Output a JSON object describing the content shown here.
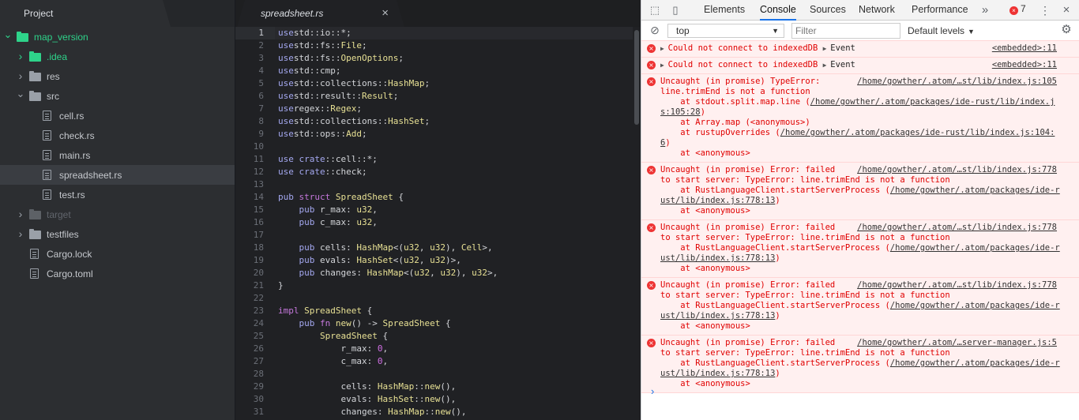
{
  "tree": {
    "tab_title": "Project",
    "items": [
      {
        "label": "map_version",
        "kind": "folder",
        "depth": 0,
        "expanded": true,
        "git": true
      },
      {
        "label": ".idea",
        "kind": "folder",
        "depth": 1,
        "expanded": false,
        "git": true
      },
      {
        "label": "res",
        "kind": "folder",
        "depth": 1,
        "expanded": false
      },
      {
        "label": "src",
        "kind": "folder",
        "depth": 1,
        "expanded": true
      },
      {
        "label": "cell.rs",
        "kind": "file",
        "depth": 2
      },
      {
        "label": "check.rs",
        "kind": "file",
        "depth": 2
      },
      {
        "label": "main.rs",
        "kind": "file",
        "depth": 2
      },
      {
        "label": "spreadsheet.rs",
        "kind": "file",
        "depth": 2,
        "selected": true
      },
      {
        "label": "test.rs",
        "kind": "file",
        "depth": 2
      },
      {
        "label": "target",
        "kind": "folder",
        "depth": 1,
        "expanded": false,
        "dim": true
      },
      {
        "label": "testfiles",
        "kind": "folder",
        "depth": 1,
        "expanded": false
      },
      {
        "label": "Cargo.lock",
        "kind": "file",
        "depth": 1
      },
      {
        "label": "Cargo.toml",
        "kind": "file",
        "depth": 1
      }
    ]
  },
  "editor": {
    "tab_title": "spreadsheet.rs",
    "close_glyph": "×",
    "active_line": 1,
    "lines": [
      [
        [
          "kw2",
          "use"
        ],
        [
          "",
          "std::io::*;"
        ]
      ],
      [
        [
          "kw2",
          "use"
        ],
        [
          "",
          "std::fs::"
        ],
        [
          "ty",
          "File"
        ],
        [
          "",
          ";"
        ]
      ],
      [
        [
          "kw2",
          "use"
        ],
        [
          "",
          "std::fs::"
        ],
        [
          "ty",
          "OpenOptions"
        ],
        [
          "",
          ";"
        ]
      ],
      [
        [
          "kw2",
          "use"
        ],
        [
          "",
          "std::cmp;"
        ]
      ],
      [
        [
          "kw2",
          "use"
        ],
        [
          "",
          "std::collections::"
        ],
        [
          "ty",
          "HashMap"
        ],
        [
          "",
          ";"
        ]
      ],
      [
        [
          "kw2",
          "use"
        ],
        [
          "",
          "std::result::"
        ],
        [
          "ty",
          "Result"
        ],
        [
          "",
          ";"
        ]
      ],
      [
        [
          "kw2",
          "use"
        ],
        [
          "",
          "regex::"
        ],
        [
          "ty",
          "Regex"
        ],
        [
          "",
          ";"
        ]
      ],
      [
        [
          "kw2",
          "use"
        ],
        [
          "",
          "std::collections::"
        ],
        [
          "ty",
          "HashSet"
        ],
        [
          "",
          ";"
        ]
      ],
      [
        [
          "kw2",
          "use"
        ],
        [
          "",
          "std::ops::"
        ],
        [
          "ty",
          "Add"
        ],
        [
          "",
          ";"
        ]
      ],
      [],
      [
        [
          "kw2",
          "use"
        ],
        [
          "",
          ""
        ],
        [
          "kw2",
          "crate"
        ],
        [
          "",
          "::cell::*;"
        ]
      ],
      [
        [
          "kw2",
          "use"
        ],
        [
          "",
          ""
        ],
        [
          "kw2",
          "crate"
        ],
        [
          "",
          "::check;"
        ]
      ],
      [],
      [
        [
          "kw2",
          "pub"
        ],
        [
          "",
          ""
        ],
        [
          "kw",
          "struct"
        ],
        [
          "",
          ""
        ],
        [
          "ty",
          "SpreadSheet"
        ],
        [
          "",
          ""
        ],
        [
          "",
          "{"
        ]
      ],
      [
        [
          "",
          "    "
        ],
        [
          "kw2",
          "pub"
        ],
        [
          "",
          ""
        ],
        [
          "",
          "r_max: "
        ],
        [
          "ty",
          "u32"
        ],
        [
          "",
          ","
        ]
      ],
      [
        [
          "",
          "    "
        ],
        [
          "kw2",
          "pub"
        ],
        [
          "",
          ""
        ],
        [
          "",
          "c_max: "
        ],
        [
          "ty",
          "u32"
        ],
        [
          "",
          ","
        ]
      ],
      [],
      [
        [
          "",
          "    "
        ],
        [
          "kw2",
          "pub"
        ],
        [
          "",
          ""
        ],
        [
          "",
          "cells: "
        ],
        [
          "ty",
          "HashMap"
        ],
        [
          "",
          "<("
        ],
        [
          "ty",
          "u32"
        ],
        [
          "",
          ", "
        ],
        [
          "ty",
          "u32"
        ],
        [
          "",
          "), "
        ],
        [
          "ty",
          "Cell"
        ],
        [
          "",
          ">,"
        ]
      ],
      [
        [
          "",
          "    "
        ],
        [
          "kw2",
          "pub"
        ],
        [
          "",
          ""
        ],
        [
          "",
          "evals: "
        ],
        [
          "ty",
          "HashSet"
        ],
        [
          "",
          "<("
        ],
        [
          "ty",
          "u32"
        ],
        [
          "",
          ", "
        ],
        [
          "ty",
          "u32"
        ],
        [
          "",
          ")>,"
        ]
      ],
      [
        [
          "",
          "    "
        ],
        [
          "kw2",
          "pub"
        ],
        [
          "",
          ""
        ],
        [
          "",
          "changes: "
        ],
        [
          "ty",
          "HashMap"
        ],
        [
          "",
          "<("
        ],
        [
          "ty",
          "u32"
        ],
        [
          "",
          ", "
        ],
        [
          "ty",
          "u32"
        ],
        [
          "",
          "), "
        ],
        [
          "ty",
          "u32"
        ],
        [
          "",
          ">,"
        ]
      ],
      [
        [
          "",
          "}"
        ]
      ],
      [],
      [
        [
          "kw",
          "impl"
        ],
        [
          "",
          ""
        ],
        [
          "ty",
          "SpreadSheet"
        ],
        [
          "",
          ""
        ],
        [
          "",
          "{"
        ]
      ],
      [
        [
          "",
          "    "
        ],
        [
          "kw2",
          "pub"
        ],
        [
          "",
          ""
        ],
        [
          "kw",
          "fn"
        ],
        [
          "",
          ""
        ],
        [
          "ty",
          "new"
        ],
        [
          "",
          "() -> "
        ],
        [
          "ty",
          "SpreadSheet"
        ],
        [
          "",
          ""
        ],
        [
          "",
          "{"
        ]
      ],
      [
        [
          "",
          "        "
        ],
        [
          "ty",
          "SpreadSheet"
        ],
        [
          "",
          ""
        ],
        [
          "",
          "{"
        ]
      ],
      [
        [
          "",
          "            "
        ],
        [
          "",
          "r_max: "
        ],
        [
          "nm",
          "0"
        ],
        [
          "",
          ","
        ]
      ],
      [
        [
          "",
          "            "
        ],
        [
          "",
          "c_max: "
        ],
        [
          "nm",
          "0"
        ],
        [
          "",
          ","
        ]
      ],
      [],
      [
        [
          "",
          "            "
        ],
        [
          "",
          "cells: "
        ],
        [
          "ty",
          "HashMap"
        ],
        [
          "",
          "::"
        ],
        [
          "ty",
          "new"
        ],
        [
          "",
          "(),"
        ]
      ],
      [
        [
          "",
          "            "
        ],
        [
          "",
          "evals: "
        ],
        [
          "ty",
          "HashSet"
        ],
        [
          "",
          "::"
        ],
        [
          "ty",
          "new"
        ],
        [
          "",
          "(),"
        ]
      ],
      [
        [
          "",
          "            "
        ],
        [
          "",
          "changes: "
        ],
        [
          "ty",
          "HashMap"
        ],
        [
          "",
          "::"
        ],
        [
          "ty",
          "new"
        ],
        [
          "",
          "(),"
        ]
      ]
    ]
  },
  "devtools": {
    "tabs": [
      "Elements",
      "Console",
      "Sources",
      "Network",
      "Performance"
    ],
    "active_tab": "Console",
    "more_glyph": "»",
    "error_count": "7",
    "menu_glyph": "⋮",
    "close_glyph": "×",
    "context": "top",
    "filter_placeholder": "Filter",
    "levels": "Default levels",
    "prompt_glyph": "›",
    "messages": [
      {
        "text": "Could not connect to indexedDB ",
        "event": "Event",
        "src": "<embedded>:11",
        "expandable": true
      },
      {
        "text": "Could not connect to indexedDB ",
        "event": "Event",
        "src": "<embedded>:11",
        "expandable": true
      },
      {
        "text": "Uncaught (in promise) TypeError:\nline.trimEnd is not a function\n    at stdout.split.map.line (",
        "link1": "/home/gowther/.atom/packages/ide-rust/lib/index.js:105:28",
        "tail1": ")\n    at Array.map (<anonymous>)\n    at rustupOverrides (",
        "link2": "/home/gowther/.atom/packages/ide-rust/lib/index.js:104:6",
        "tail2": ")\n    at <anonymous>",
        "src": "/home/gowther/.atom/…st/lib/index.js:105"
      },
      {
        "text": "Uncaught (in promise) Error: failed\nto start server: TypeError: line.trimEnd is not a function\n    at RustLanguageClient.startServerProcess (",
        "link1": "/home/gowther/.atom/packages/ide-rust/lib/index.js:778:13",
        "tail1": ")\n    at <anonymous>",
        "src": "/home/gowther/.atom/…st/lib/index.js:778"
      },
      {
        "text": "Uncaught (in promise) Error: failed\nto start server: TypeError: line.trimEnd is not a function\n    at RustLanguageClient.startServerProcess (",
        "link1": "/home/gowther/.atom/packages/ide-rust/lib/index.js:778:13",
        "tail1": ")\n    at <anonymous>",
        "src": "/home/gowther/.atom/…st/lib/index.js:778"
      },
      {
        "text": "Uncaught (in promise) Error: failed\nto start server: TypeError: line.trimEnd is not a function\n    at RustLanguageClient.startServerProcess (",
        "link1": "/home/gowther/.atom/packages/ide-rust/lib/index.js:778:13",
        "tail1": ")\n    at <anonymous>",
        "src": "/home/gowther/.atom/…st/lib/index.js:778"
      },
      {
        "text": "Uncaught (in promise) Error: failed\nto start server: TypeError: line.trimEnd is not a function\n    at RustLanguageClient.startServerProcess (",
        "link1": "/home/gowther/.atom/packages/ide-rust/lib/index.js:778:13",
        "tail1": ")\n    at <anonymous>",
        "src": "/home/gowther/.atom/…server-manager.js:5"
      }
    ]
  }
}
